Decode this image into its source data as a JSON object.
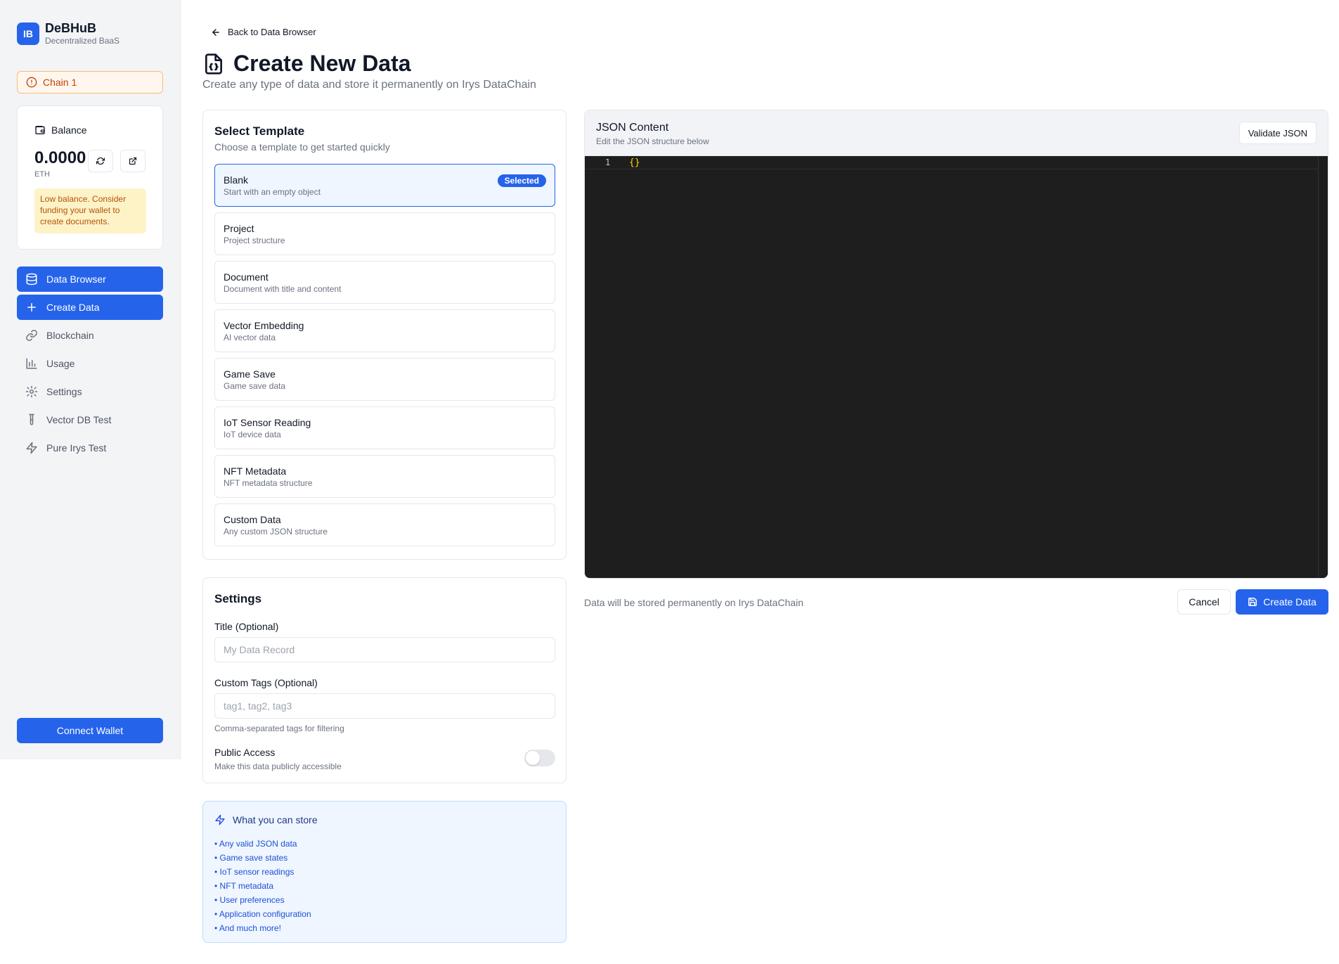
{
  "brand": {
    "logo": "IB",
    "name": "DeBHuB",
    "subtitle": "Decentralized BaaS"
  },
  "chain": {
    "label": "Chain 1",
    "icon": "alert-circle-icon"
  },
  "balance": {
    "label": "Balance",
    "amount": "0.0000",
    "unit": "ETH",
    "warning": "Low balance. Consider funding your wallet to create documents."
  },
  "nav": {
    "items": [
      {
        "label": "Data Browser",
        "icon": "database-icon",
        "active": true
      },
      {
        "label": "Create Data",
        "icon": "plus-icon",
        "active": true
      },
      {
        "label": "Blockchain",
        "icon": "link-icon",
        "active": false
      },
      {
        "label": "Usage",
        "icon": "bar-chart-icon",
        "active": false
      },
      {
        "label": "Settings",
        "icon": "gear-icon",
        "active": false
      },
      {
        "label": "Vector DB Test",
        "icon": "test-tube-icon",
        "active": false
      },
      {
        "label": "Pure Irys Test",
        "icon": "zap-icon",
        "active": false
      }
    ]
  },
  "connect_wallet": "Connect Wallet",
  "header": {
    "back_link": "Back to Data Browser",
    "title": "Create New Data",
    "subtitle": "Create any type of data and store it permanently on Irys DataChain"
  },
  "templates": {
    "title": "Select Template",
    "subtitle": "Choose a template to get started quickly",
    "selected_badge": "Selected",
    "items": [
      {
        "name": "Blank",
        "desc": "Start with an empty object",
        "selected": true
      },
      {
        "name": "Project",
        "desc": "Project structure",
        "selected": false
      },
      {
        "name": "Document",
        "desc": "Document with title and content",
        "selected": false
      },
      {
        "name": "Vector Embedding",
        "desc": "AI vector data",
        "selected": false
      },
      {
        "name": "Game Save",
        "desc": "Game save data",
        "selected": false
      },
      {
        "name": "IoT Sensor Reading",
        "desc": "IoT device data",
        "selected": false
      },
      {
        "name": "NFT Metadata",
        "desc": "NFT metadata structure",
        "selected": false
      },
      {
        "name": "Custom Data",
        "desc": "Any custom JSON structure",
        "selected": false
      }
    ]
  },
  "settings": {
    "title": "Settings",
    "title_label": "Title (Optional)",
    "title_placeholder": "My Data Record",
    "tags_label": "Custom Tags (Optional)",
    "tags_placeholder": "tag1, tag2, tag3",
    "tags_hint": "Comma-separated tags for filtering",
    "public_label": "Public Access",
    "public_hint": "Make this data publicly accessible",
    "public_enabled": false
  },
  "info": {
    "title": "What you can store",
    "items": [
      "• Any valid JSON data",
      "• Game save states",
      "• IoT sensor readings",
      "• NFT metadata",
      "• User preferences",
      "• Application configuration",
      "• And much more!"
    ]
  },
  "json": {
    "title": "JSON Content",
    "subtitle": "Edit the JSON structure below",
    "validate_label": "Validate JSON",
    "line_number": "1",
    "content": "{}"
  },
  "footer": {
    "note": "Data will be stored permanently on Irys DataChain",
    "cancel": "Cancel",
    "create": "Create Data"
  },
  "colors": {
    "accent": "#2563eb",
    "warning_bg": "#fef3c7",
    "editor_bg": "#1e1e1e"
  }
}
